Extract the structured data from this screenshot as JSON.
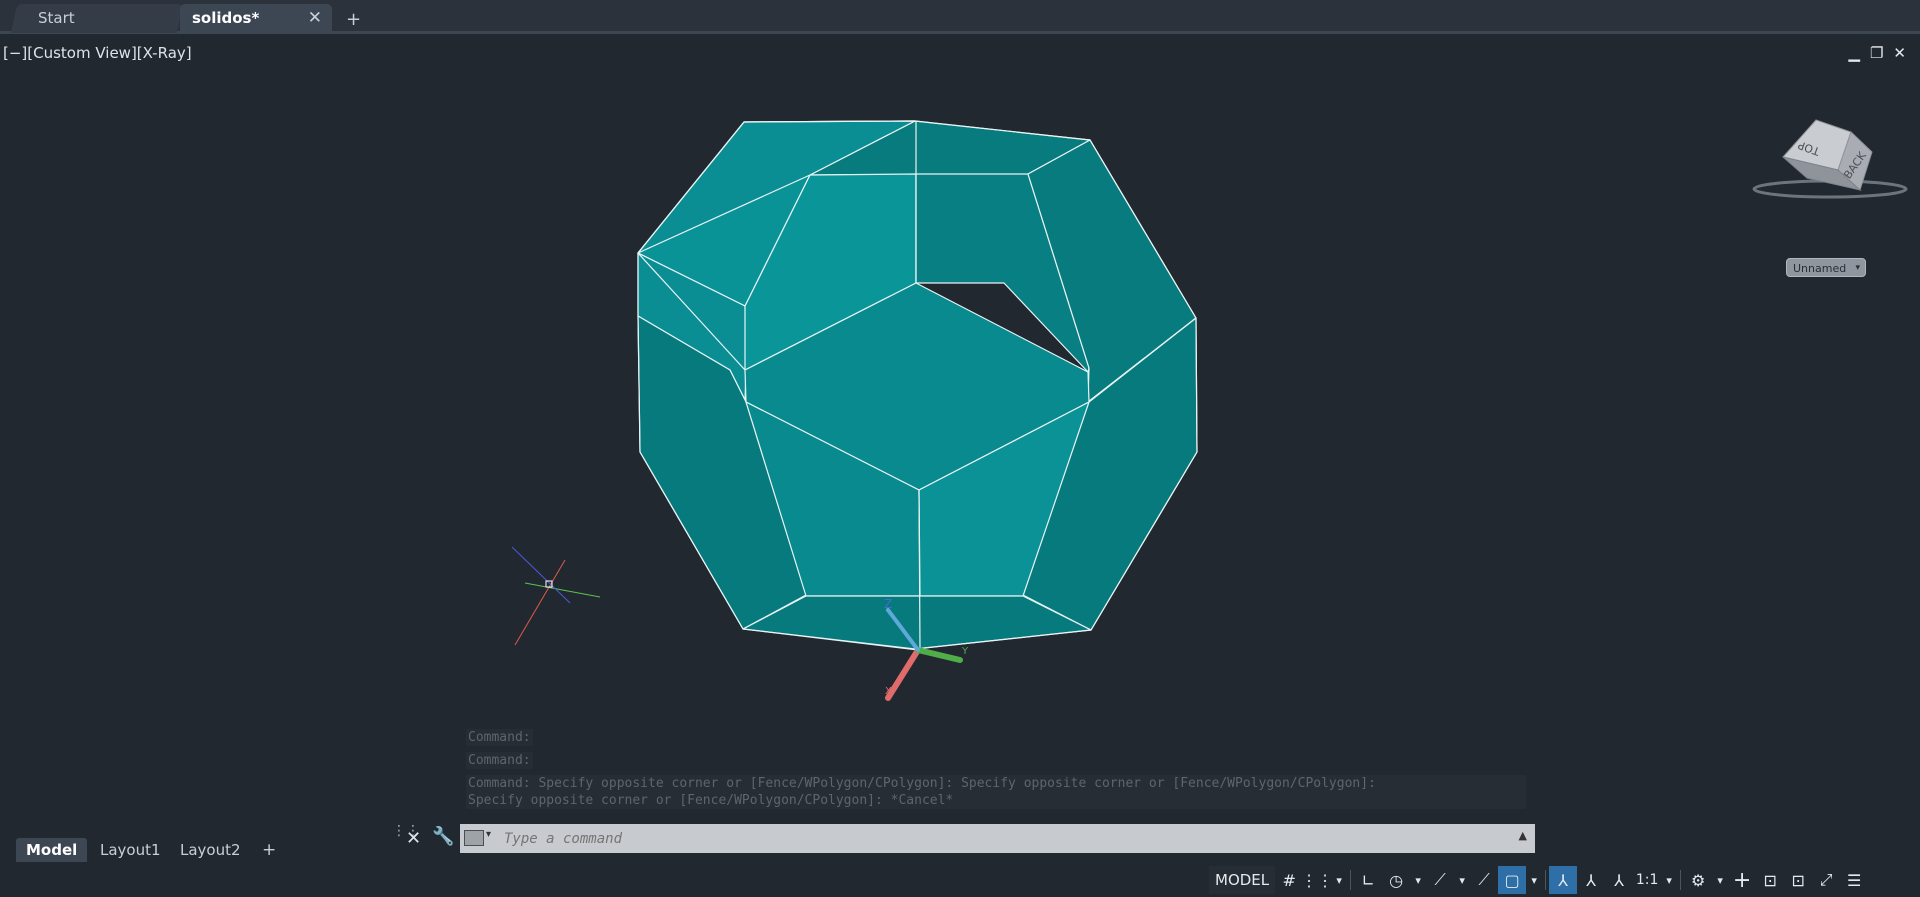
{
  "tabs": {
    "start_label": "Start",
    "active_label": "solidos*",
    "close_glyph": "✕",
    "new_glyph": "+"
  },
  "viewport": {
    "label": "[−][Custom View][X-Ray]",
    "minimize_glyph": "▁",
    "restore_glyph": "❐",
    "close_glyph": "✕"
  },
  "viewcube": {
    "top_label": "TOP",
    "back_label": "BACK",
    "named_view": "Unnamed"
  },
  "ucs": {
    "z_label": "Z",
    "y_label": "Y",
    "x_label": "X"
  },
  "command_history": {
    "line1": "Command:",
    "line2": "Command:",
    "line3": "Command: Specify opposite corner or [Fence/WPolygon/CPolygon]:  Specify opposite corner or [Fence/WPolygon/CPolygon]:",
    "line4": "Specify opposite corner or [Fence/WPolygon/CPolygon]: *Cancel*"
  },
  "command_line": {
    "placeholder": "Type a command",
    "close_glyph": "✕",
    "customize_glyph": "🔧",
    "expand_glyph": "▲"
  },
  "layout_tabs": {
    "items": [
      "Model",
      "Layout1",
      "Layout2"
    ],
    "add_glyph": "+"
  },
  "status_bar": {
    "model_label": "MODEL",
    "scale_label": "1:1",
    "grid_glyph": "#",
    "snap_glyph": "⋮⋮",
    "ortho_glyph": "∟",
    "polar_glyph": "◷",
    "isodraft_glyph": "⟋",
    "osnap_glyph": "▢",
    "annotation_glyph": "⅄",
    "settings_glyph": "⚙",
    "plus_glyph": "+",
    "workspace_glyph": "⊡",
    "fullscreen_glyph": "⤢",
    "menu_glyph": "☰",
    "dropdown_glyph": "▾"
  },
  "colors": {
    "background": "#212830",
    "solid_face": "#0b8e93",
    "edge": "#e8f4f4",
    "active_toggle": "#2e6fa8"
  }
}
